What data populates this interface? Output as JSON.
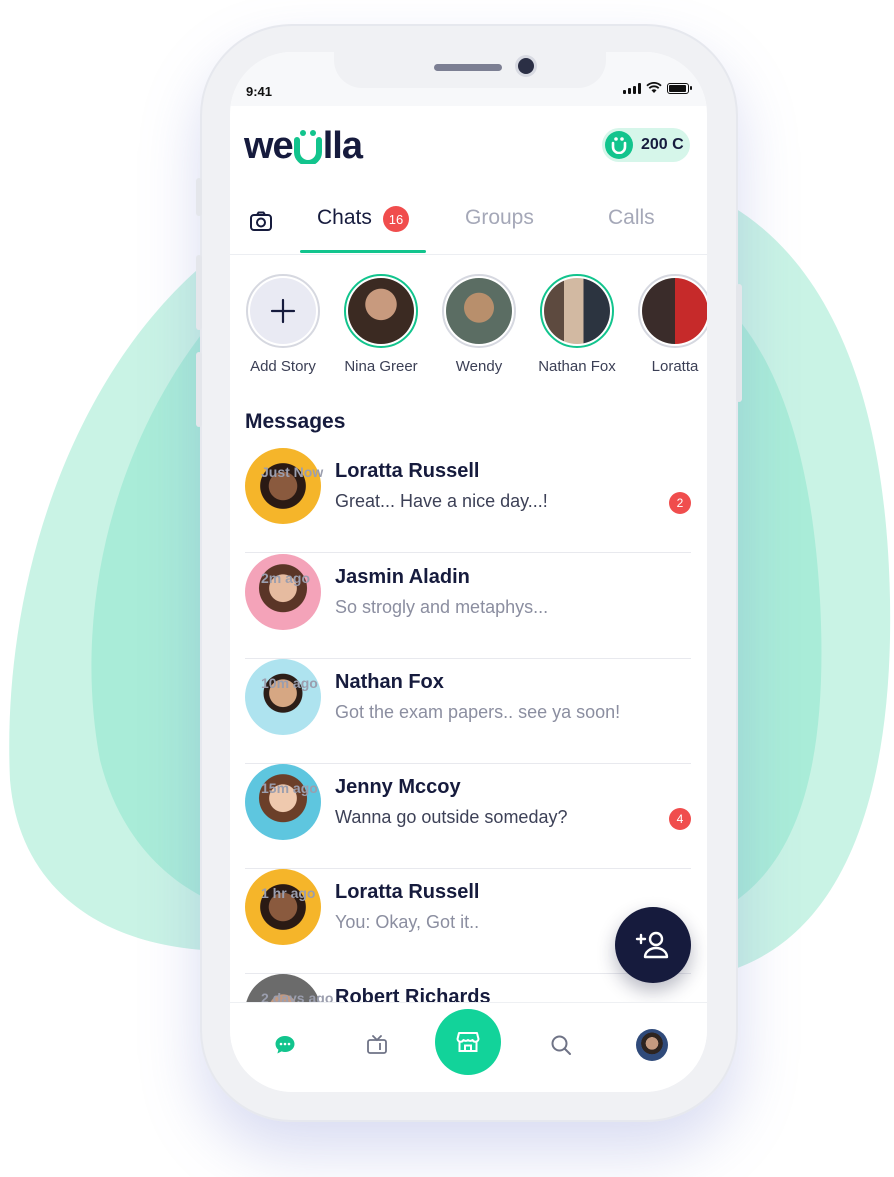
{
  "status_bar": {
    "time": "9:41"
  },
  "header": {
    "logo_prefix": "we",
    "logo_mid": "U",
    "logo_suffix": "lla",
    "coins": "200 C"
  },
  "tabs": {
    "items": [
      {
        "label": "Chats",
        "badge": "16",
        "active": true
      },
      {
        "label": "Groups"
      },
      {
        "label": "Calls"
      }
    ]
  },
  "stories": [
    {
      "label": "Add Story"
    },
    {
      "label": "Nina Greer"
    },
    {
      "label": "Wendy"
    },
    {
      "label": "Nathan Fox"
    },
    {
      "label": "Loratta"
    }
  ],
  "messages": {
    "title": "Messages",
    "items": [
      {
        "name": "Loratta Russell",
        "preview": "Great... Have a nice day...!",
        "time": "Just Now",
        "badge": "2"
      },
      {
        "name": "Jasmin Aladin",
        "preview": "So strogly and metaphys...",
        "time": "2m ago"
      },
      {
        "name": "Nathan Fox",
        "preview": "Got the exam papers.. see ya soon!",
        "time": "10m ago"
      },
      {
        "name": "Jenny Mccoy",
        "preview": "Wanna go outside someday?",
        "time": "15m ago",
        "badge": "4"
      },
      {
        "name": "Loratta Russell",
        "preview": "You: Okay, Got it..",
        "time": "1 hr ago"
      },
      {
        "name": "Robert Richards",
        "preview": "",
        "time": "2 days ago"
      }
    ]
  },
  "colors": {
    "accent": "#12c48d",
    "dark": "#161b3d",
    "badge": "#f04d4d"
  }
}
